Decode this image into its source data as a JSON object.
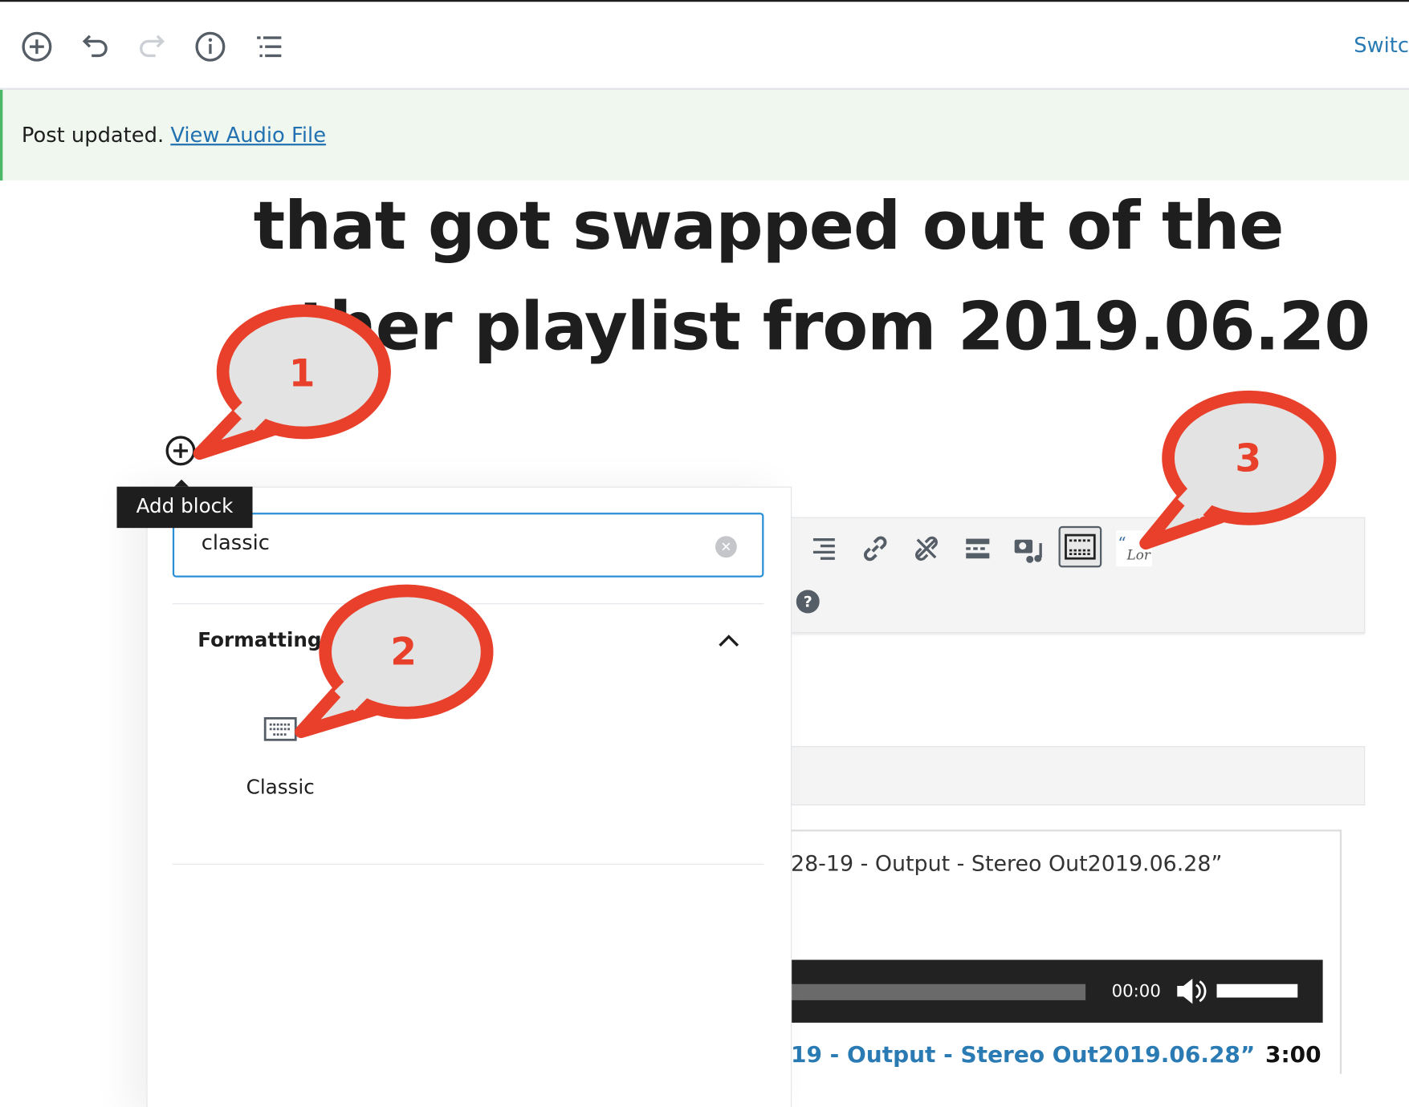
{
  "toolbar": {
    "icons": [
      "add-block-icon",
      "undo-icon",
      "redo-icon",
      "info-icon",
      "list-view-icon"
    ],
    "switch_label": "Switc"
  },
  "notice": {
    "text": "Post updated.",
    "link": "View Audio File",
    "bg_color": "#eff7ef",
    "accent_color": "#4ab866"
  },
  "post": {
    "title_line1": "that got swapped out of the",
    "title_line2": "other playlist from 2019.06.20"
  },
  "inserter": {
    "tooltip": "Add block",
    "search_value": "classic",
    "category": "Formatting",
    "block_label": "Classic",
    "block_icon": "keyboard-icon"
  },
  "classic_toolbar": {
    "icons": [
      "align-right-icon",
      "link-icon",
      "unlink-icon",
      "read-more-icon",
      "add-media-icon",
      "toolbar-toggle-icon",
      "blockquote-plugin-icon",
      "help-icon"
    ]
  },
  "audio": {
    "caption": "28-19 - Output - Stereo Out2019.06.28”",
    "time": "00:00",
    "track_title": "19 - Output - Stereo Out2019.06.28”",
    "duration": "3:00"
  },
  "callouts": [
    {
      "label": "1"
    },
    {
      "label": "2"
    },
    {
      "label": "3"
    }
  ],
  "colors": {
    "callout_border": "#e8402a",
    "callout_fill": "#e3e3e3",
    "link": "#2a7ab3"
  }
}
